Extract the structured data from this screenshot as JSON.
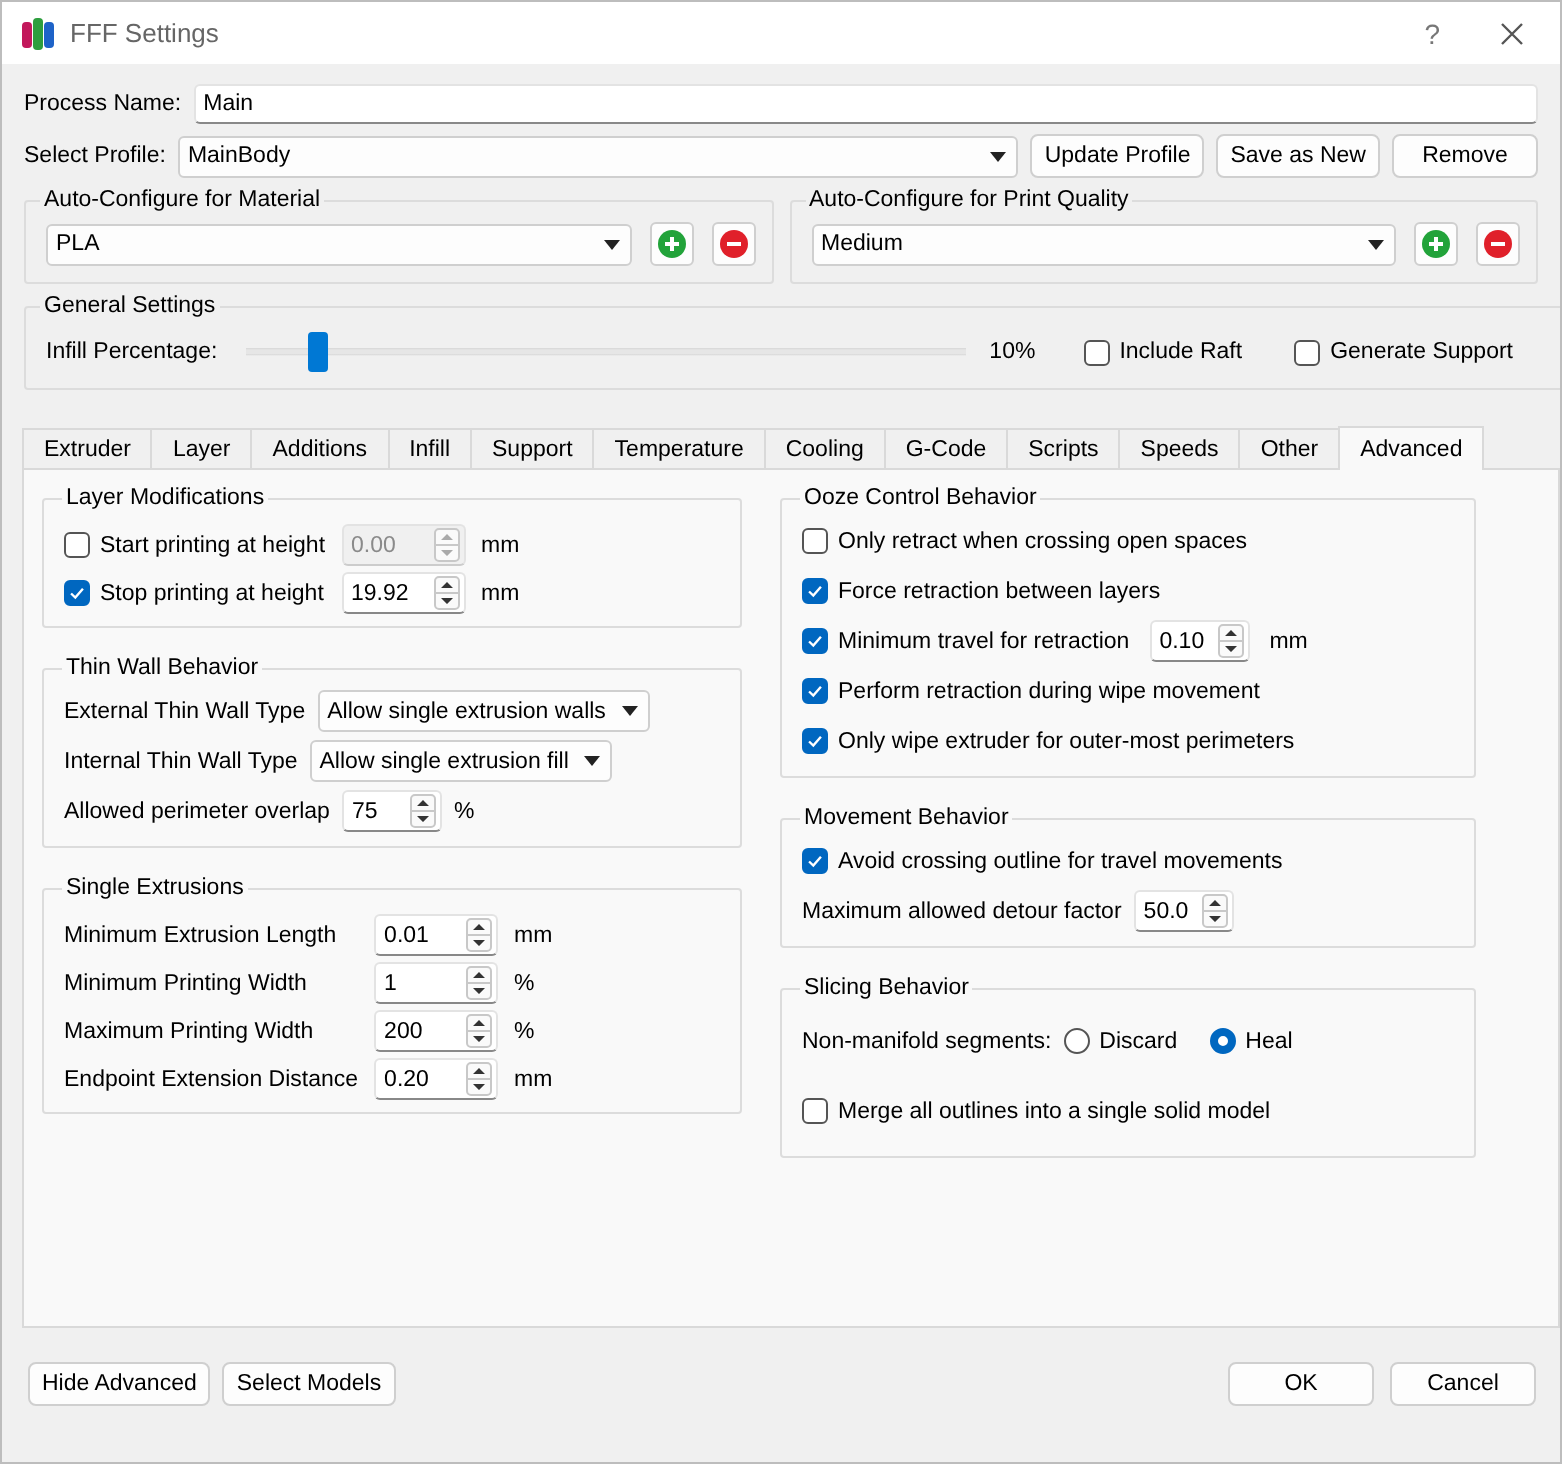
{
  "window": {
    "title": "FFF Settings",
    "help": "?"
  },
  "process_name": {
    "label": "Process Name:",
    "value": "Main"
  },
  "profile": {
    "label": "Select Profile:",
    "value": "MainBody",
    "buttons": [
      "Update Profile",
      "Save as New",
      "Remove"
    ]
  },
  "auto_configure": [
    {
      "title": "Auto-Configure for Material",
      "value": "PLA"
    },
    {
      "title": "Auto-Configure for Print Quality",
      "value": "Medium"
    }
  ],
  "general": {
    "title": "General Settings",
    "infill_label": "Infill Percentage:",
    "infill": {
      "level": 0.1
    },
    "infill_reading": "10%",
    "checks": [
      {
        "label": "Include Raft",
        "checked": false
      },
      {
        "label": "Generate Support",
        "checked": false
      }
    ]
  },
  "tabs": [
    {
      "label": "Extruder",
      "selected": false
    },
    {
      "label": "Layer",
      "selected": false
    },
    {
      "label": "Additions",
      "selected": false
    },
    {
      "label": "Infill",
      "selected": false
    },
    {
      "label": "Support",
      "selected": false
    },
    {
      "label": "Temperature",
      "selected": false
    },
    {
      "label": "Cooling",
      "selected": false
    },
    {
      "label": "G-Code",
      "selected": false
    },
    {
      "label": "Scripts",
      "selected": false
    },
    {
      "label": "Speeds",
      "selected": false
    },
    {
      "label": "Other",
      "selected": false
    },
    {
      "label": "Advanced",
      "selected": true
    }
  ],
  "pane": {
    "columns": [
      {
        "groups": [
          {
            "title": "Layer Modifications",
            "rows": [
              {
                "kind": "check_spin",
                "label": "Start printing at height",
                "checked": false,
                "value": "0.00",
                "unit": "mm",
                "disabled": true
              },
              {
                "kind": "check_spin",
                "label": "Stop printing at height",
                "checked": true,
                "value": "19.92",
                "unit": "mm",
                "disabled": false
              }
            ]
          },
          {
            "title": "Thin Wall Behavior",
            "rows": [
              {
                "kind": "select",
                "label": "External Thin Wall Type",
                "value": "Allow single extrusion walls"
              },
              {
                "kind": "select",
                "label": "Internal Thin Wall Type",
                "value": "Allow single extrusion fill"
              },
              {
                "kind": "spin",
                "label": "Allowed perimeter overlap",
                "value": "75",
                "unit": "%"
              }
            ]
          },
          {
            "title": "Single Extrusions",
            "rows": [
              {
                "kind": "spin",
                "label": "Minimum Extrusion Length",
                "value": "0.01",
                "unit": "mm"
              },
              {
                "kind": "spin",
                "label": "Minimum Printing Width",
                "value": "1",
                "unit": "%"
              },
              {
                "kind": "spin",
                "label": "Maximum Printing Width",
                "value": "200",
                "unit": "%"
              },
              {
                "kind": "spin",
                "label": "Endpoint Extension Distance",
                "value": "0.20",
                "unit": "mm"
              }
            ]
          }
        ]
      },
      {
        "groups": [
          {
            "title": "Ooze Control Behavior",
            "rows": [
              {
                "kind": "check",
                "label": "Only retract when crossing open spaces",
                "checked": false
              },
              {
                "kind": "check",
                "label": "Force retraction between layers",
                "checked": true
              },
              {
                "kind": "check_spin",
                "label": "Minimum travel for retraction",
                "checked": true,
                "value": "0.10",
                "unit": "mm",
                "disabled": false
              },
              {
                "kind": "check",
                "label": "Perform retraction during wipe movement",
                "checked": true
              },
              {
                "kind": "check",
                "label": "Only wipe extruder for outer-most perimeters",
                "checked": true
              }
            ]
          },
          {
            "title": "Movement Behavior",
            "rows": [
              {
                "kind": "check",
                "label": "Avoid crossing outline for travel movements",
                "checked": true
              },
              {
                "kind": "spin",
                "label": "Maximum allowed detour factor",
                "value": "50.0"
              }
            ]
          },
          {
            "title": "Slicing Behavior",
            "rows": [
              {
                "kind": "radio",
                "label": "Non-manifold segments:",
                "options": [
                  {
                    "label": "Discard",
                    "selected": false
                  },
                  {
                    "label": "Heal",
                    "selected": true
                  }
                ]
              },
              {
                "kind": "check",
                "label": "Merge all outlines into a single solid model",
                "checked": false
              }
            ]
          }
        ]
      }
    ]
  },
  "footer": {
    "left": [
      "Hide Advanced",
      "Select Models"
    ],
    "right": [
      "OK",
      "Cancel"
    ]
  }
}
